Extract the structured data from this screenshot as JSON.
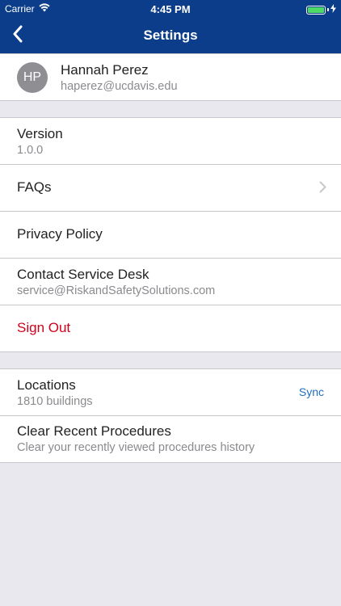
{
  "status_bar": {
    "carrier": "Carrier",
    "time": "4:45 PM",
    "battery_level": 1.0,
    "battery_color": "#4cd964"
  },
  "nav": {
    "title": "Settings",
    "back_icon": "chevron-left-icon",
    "bar_color": "#0c3d8a"
  },
  "profile": {
    "initials": "HP",
    "name": "Hannah Perez",
    "email": "haperez@ucdavis.edu"
  },
  "info": {
    "version_label": "Version",
    "version_value": "1.0.0",
    "faqs_label": "FAQs",
    "privacy_label": "Privacy Policy",
    "contact_label": "Contact Service Desk",
    "contact_email": "service@RiskandSafetySolutions.com",
    "signout_label": "Sign Out",
    "signout_color": "#d0021b"
  },
  "data": {
    "locations_label": "Locations",
    "locations_count": "1810 buildings",
    "sync_label": "Sync",
    "clear_label": "Clear Recent Procedures",
    "clear_sub": "Clear your recently viewed procedures history"
  }
}
